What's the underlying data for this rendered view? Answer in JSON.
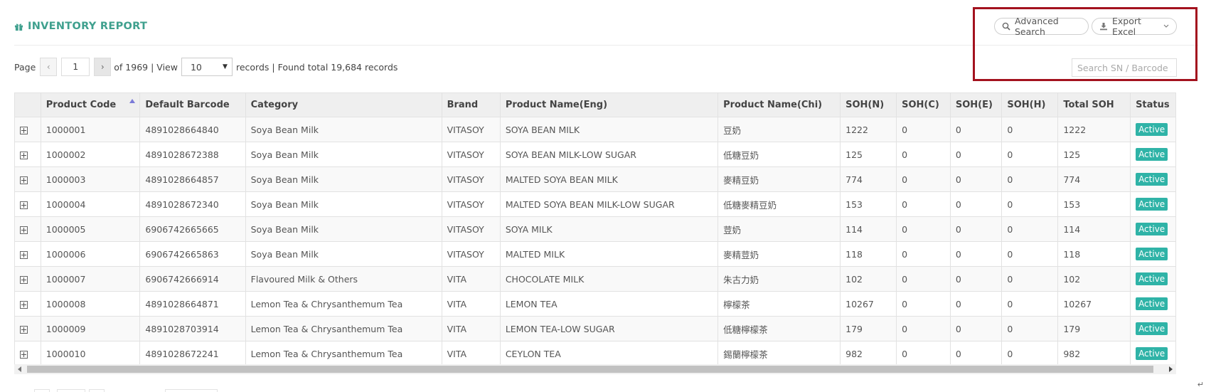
{
  "header": {
    "title": "INVENTORY REPORT",
    "icon": "gift-icon"
  },
  "toolbar": {
    "advanced_search_label": "Advanced Search",
    "export_excel_label": "Export Excel",
    "search_placeholder": "Search SN / Barcode / Pr"
  },
  "pager": {
    "page_label": "Page",
    "current_page": "1",
    "of_label": "of 1969",
    "view_label": "| View",
    "view_value": "10",
    "records_label": "records | Found total 19,684 records"
  },
  "table": {
    "columns": [
      "",
      "Product Code",
      "Default Barcode",
      "Category",
      "Brand",
      "Product Name(Eng)",
      "Product Name(Chi)",
      "SOH(N)",
      "SOH(C)",
      "SOH(E)",
      "SOH(H)",
      "Total SOH",
      "Status"
    ],
    "sorted_column": "Product Code",
    "rows": [
      [
        "1000001",
        "4891028664840",
        "Soya Bean Milk",
        "VITASOY",
        "SOYA BEAN MILK",
        "豆奶",
        "1222",
        "0",
        "0",
        "0",
        "1222",
        "Active"
      ],
      [
        "1000002",
        "4891028672388",
        "Soya Bean Milk",
        "VITASOY",
        "SOYA BEAN MILK-LOW SUGAR",
        "低糖豆奶",
        "125",
        "0",
        "0",
        "0",
        "125",
        "Active"
      ],
      [
        "1000003",
        "4891028664857",
        "Soya Bean Milk",
        "VITASOY",
        "MALTED SOYA BEAN MILK",
        "麥精豆奶",
        "774",
        "0",
        "0",
        "0",
        "774",
        "Active"
      ],
      [
        "1000004",
        "4891028672340",
        "Soya Bean Milk",
        "VITASOY",
        "MALTED SOYA BEAN MILK-LOW SUGAR",
        "低糖麥精豆奶",
        "153",
        "0",
        "0",
        "0",
        "153",
        "Active"
      ],
      [
        "1000005",
        "6906742665665",
        "Soya Bean Milk",
        "VITASOY",
        "SOYA MILK",
        "荳奶",
        "114",
        "0",
        "0",
        "0",
        "114",
        "Active"
      ],
      [
        "1000006",
        "6906742665863",
        "Soya Bean Milk",
        "VITASOY",
        "MALTED MILK",
        "麥精荳奶",
        "118",
        "0",
        "0",
        "0",
        "118",
        "Active"
      ],
      [
        "1000007",
        "6906742666914",
        "Flavoured Milk & Others",
        "VITA",
        "CHOCOLATE MILK",
        "朱古力奶",
        "102",
        "0",
        "0",
        "0",
        "102",
        "Active"
      ],
      [
        "1000008",
        "4891028664871",
        "Lemon Tea & Chrysanthemum Tea",
        "VITA",
        "LEMON TEA",
        "檸檬茶",
        "10267",
        "0",
        "0",
        "0",
        "10267",
        "Active"
      ],
      [
        "1000009",
        "4891028703914",
        "Lemon Tea & Chrysanthemum Tea",
        "VITA",
        "LEMON TEA-LOW SUGAR",
        "低糖檸檬茶",
        "179",
        "0",
        "0",
        "0",
        "179",
        "Active"
      ],
      [
        "1000010",
        "4891028672241",
        "Lemon Tea & Chrysanthemum Tea",
        "VITA",
        "CEYLON TEA",
        "錫蘭檸檬茶",
        "982",
        "0",
        "0",
        "0",
        "982",
        "Active"
      ]
    ]
  },
  "colors": {
    "accent": "#3fa08e",
    "badge": "#2fb3a7",
    "highlight": "#a3121e",
    "sort_indicator": "#7a7ad8"
  }
}
